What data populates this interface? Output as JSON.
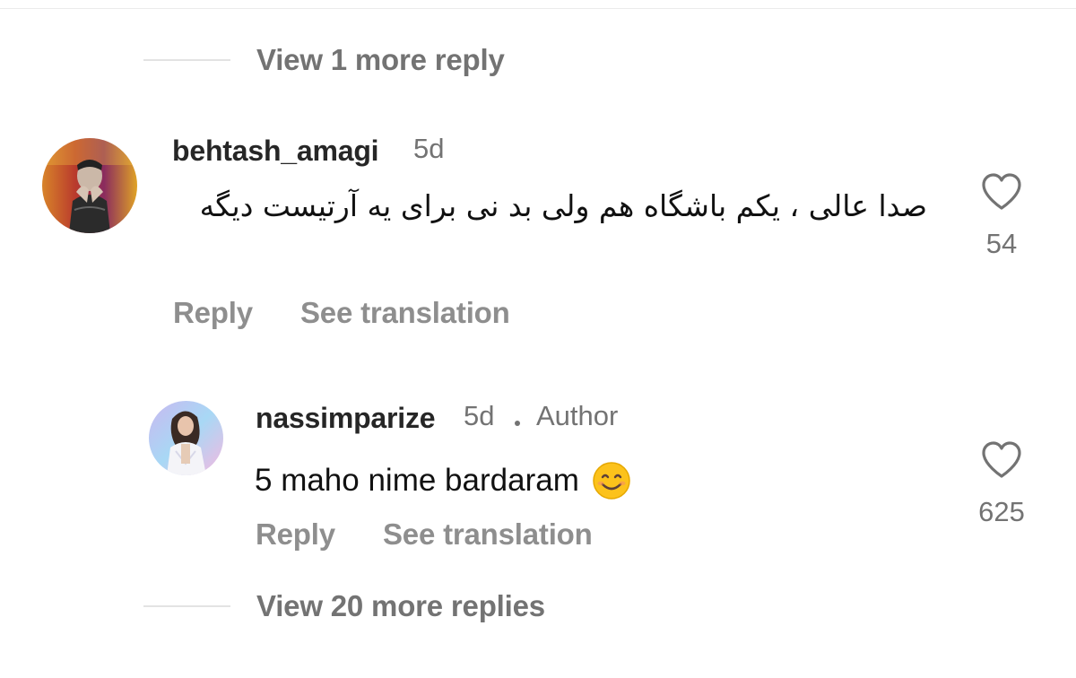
{
  "thread": {
    "view_more_top": "View 1 more reply",
    "view_more_bottom": "View 20 more replies"
  },
  "comments": [
    {
      "username": "behtash_amagi",
      "time": "5d",
      "text": "صدا عالی ، یکم باشگاه هم ولی بد نی برای یه آرتیست دیگه",
      "likes": "54",
      "reply_label": "Reply",
      "translate_label": "See translation",
      "icons": [
        "avatar",
        "heart-icon"
      ]
    },
    {
      "username": "nassimparize",
      "time": "5d",
      "badge": "Author",
      "text": "5 maho nime bardaram",
      "emoji": "smiling-face-emoji",
      "likes": "625",
      "reply_label": "Reply",
      "translate_label": "See translation",
      "icons": [
        "avatar",
        "heart-icon"
      ]
    }
  ],
  "colors": {
    "primary_text": "#262626",
    "secondary_text": "#737373",
    "action_text": "#8e8e8e",
    "divider": "#e3e3e3"
  }
}
